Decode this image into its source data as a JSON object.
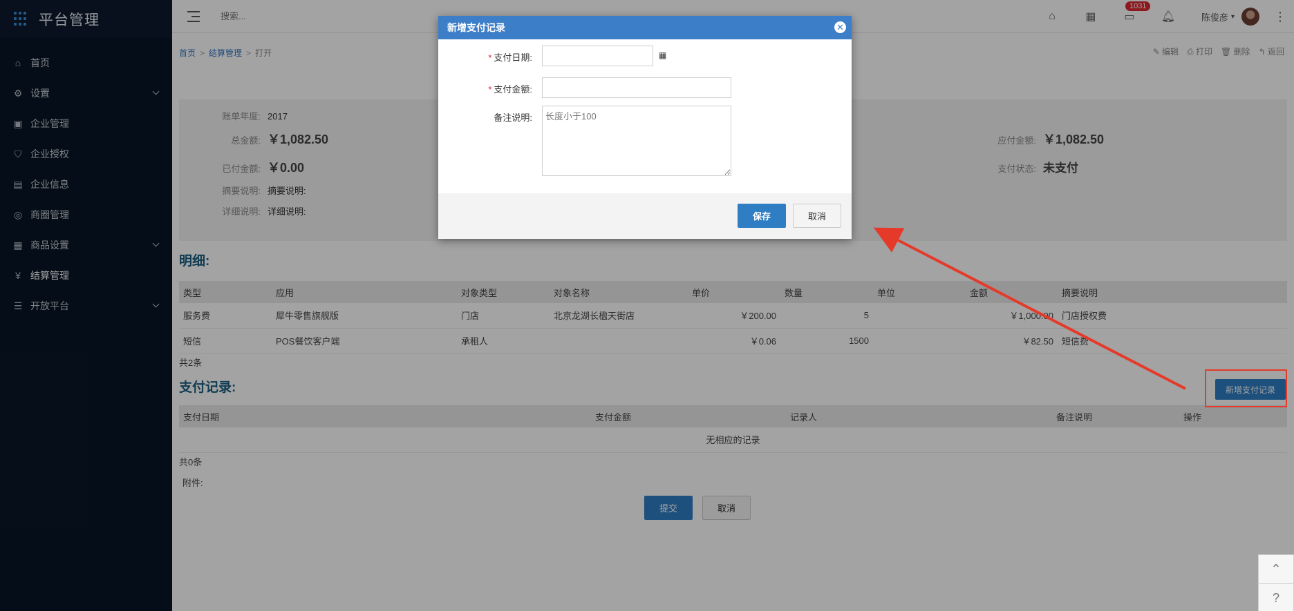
{
  "app": {
    "title": "平台管理"
  },
  "sidebar": {
    "items": [
      {
        "label": "首页",
        "icon": "home-icon"
      },
      {
        "label": "设置",
        "icon": "gear-icon",
        "expandable": true
      },
      {
        "label": "企业管理",
        "icon": "building-icon"
      },
      {
        "label": "企业授权",
        "icon": "shield-icon"
      },
      {
        "label": "企业信息",
        "icon": "card-icon"
      },
      {
        "label": "商圈管理",
        "icon": "compass-icon"
      },
      {
        "label": "商品设置",
        "icon": "grid-icon",
        "expandable": true
      },
      {
        "label": "结算管理",
        "icon": "yuan-icon",
        "active": true
      },
      {
        "label": "开放平台",
        "icon": "list-icon",
        "expandable": true
      }
    ]
  },
  "topbar": {
    "search_placeholder": "搜索...",
    "badge_count": "1031",
    "user_name": "陈俊彦"
  },
  "breadcrumb": {
    "home": "首页",
    "section": "结算管理",
    "current": "打开"
  },
  "page_actions": {
    "edit": "编辑",
    "print": "打印",
    "delete": "删除",
    "back": "返回"
  },
  "summary": {
    "year_label": "账单年度:",
    "year_value": "2017",
    "total_label": "总金额:",
    "total_value": "￥1,082.50",
    "payable_label": "应付金额:",
    "payable_value": "￥1,082.50",
    "paid_label": "已付金额:",
    "paid_value": "￥0.00",
    "status_label": "支付状态:",
    "status_value": "未支付",
    "brief_label": "摘要说明:",
    "brief_value": "摘要说明:",
    "detail_label": "详细说明:",
    "detail_value": "详细说明:"
  },
  "detail": {
    "title": "明细:",
    "columns": [
      "类型",
      "应用",
      "对象类型",
      "对象名称",
      "单价",
      "数量",
      "单位",
      "金额",
      "摘要说明"
    ],
    "rows": [
      [
        "服务费",
        "犀牛零售旗舰版",
        "门店",
        "北京龙湖长楹天街店",
        "￥200.00",
        "5",
        "",
        "￥1,000.00",
        "门店授权费"
      ],
      [
        "短信",
        "POS餐饮客户端",
        "承租人",
        "",
        "￥0.06",
        "1500",
        "",
        "￥82.50",
        "短信费"
      ]
    ],
    "count": "共2条"
  },
  "payments": {
    "title": "支付记录:",
    "add_button": "新增支付记录",
    "columns": [
      "支付日期",
      "支付金额",
      "记录人",
      "备注说明",
      "操作"
    ],
    "empty": "无相应的记录",
    "count": "共0条",
    "attachment_label": "附件:"
  },
  "form_actions": {
    "submit": "提交",
    "cancel": "取消"
  },
  "modal": {
    "title": "新增支付记录",
    "date_label": "支付日期:",
    "amount_label": "支付金额:",
    "remark_label": "备注说明:",
    "remark_placeholder": "长度小于100",
    "save": "保存",
    "cancel": "取消"
  },
  "colors": {
    "sidebar_bg": "#091627",
    "primary": "#2f7ec4",
    "modal_header": "#3d7ec9",
    "annotation": "#e53a2a",
    "badge": "#d9282f"
  }
}
